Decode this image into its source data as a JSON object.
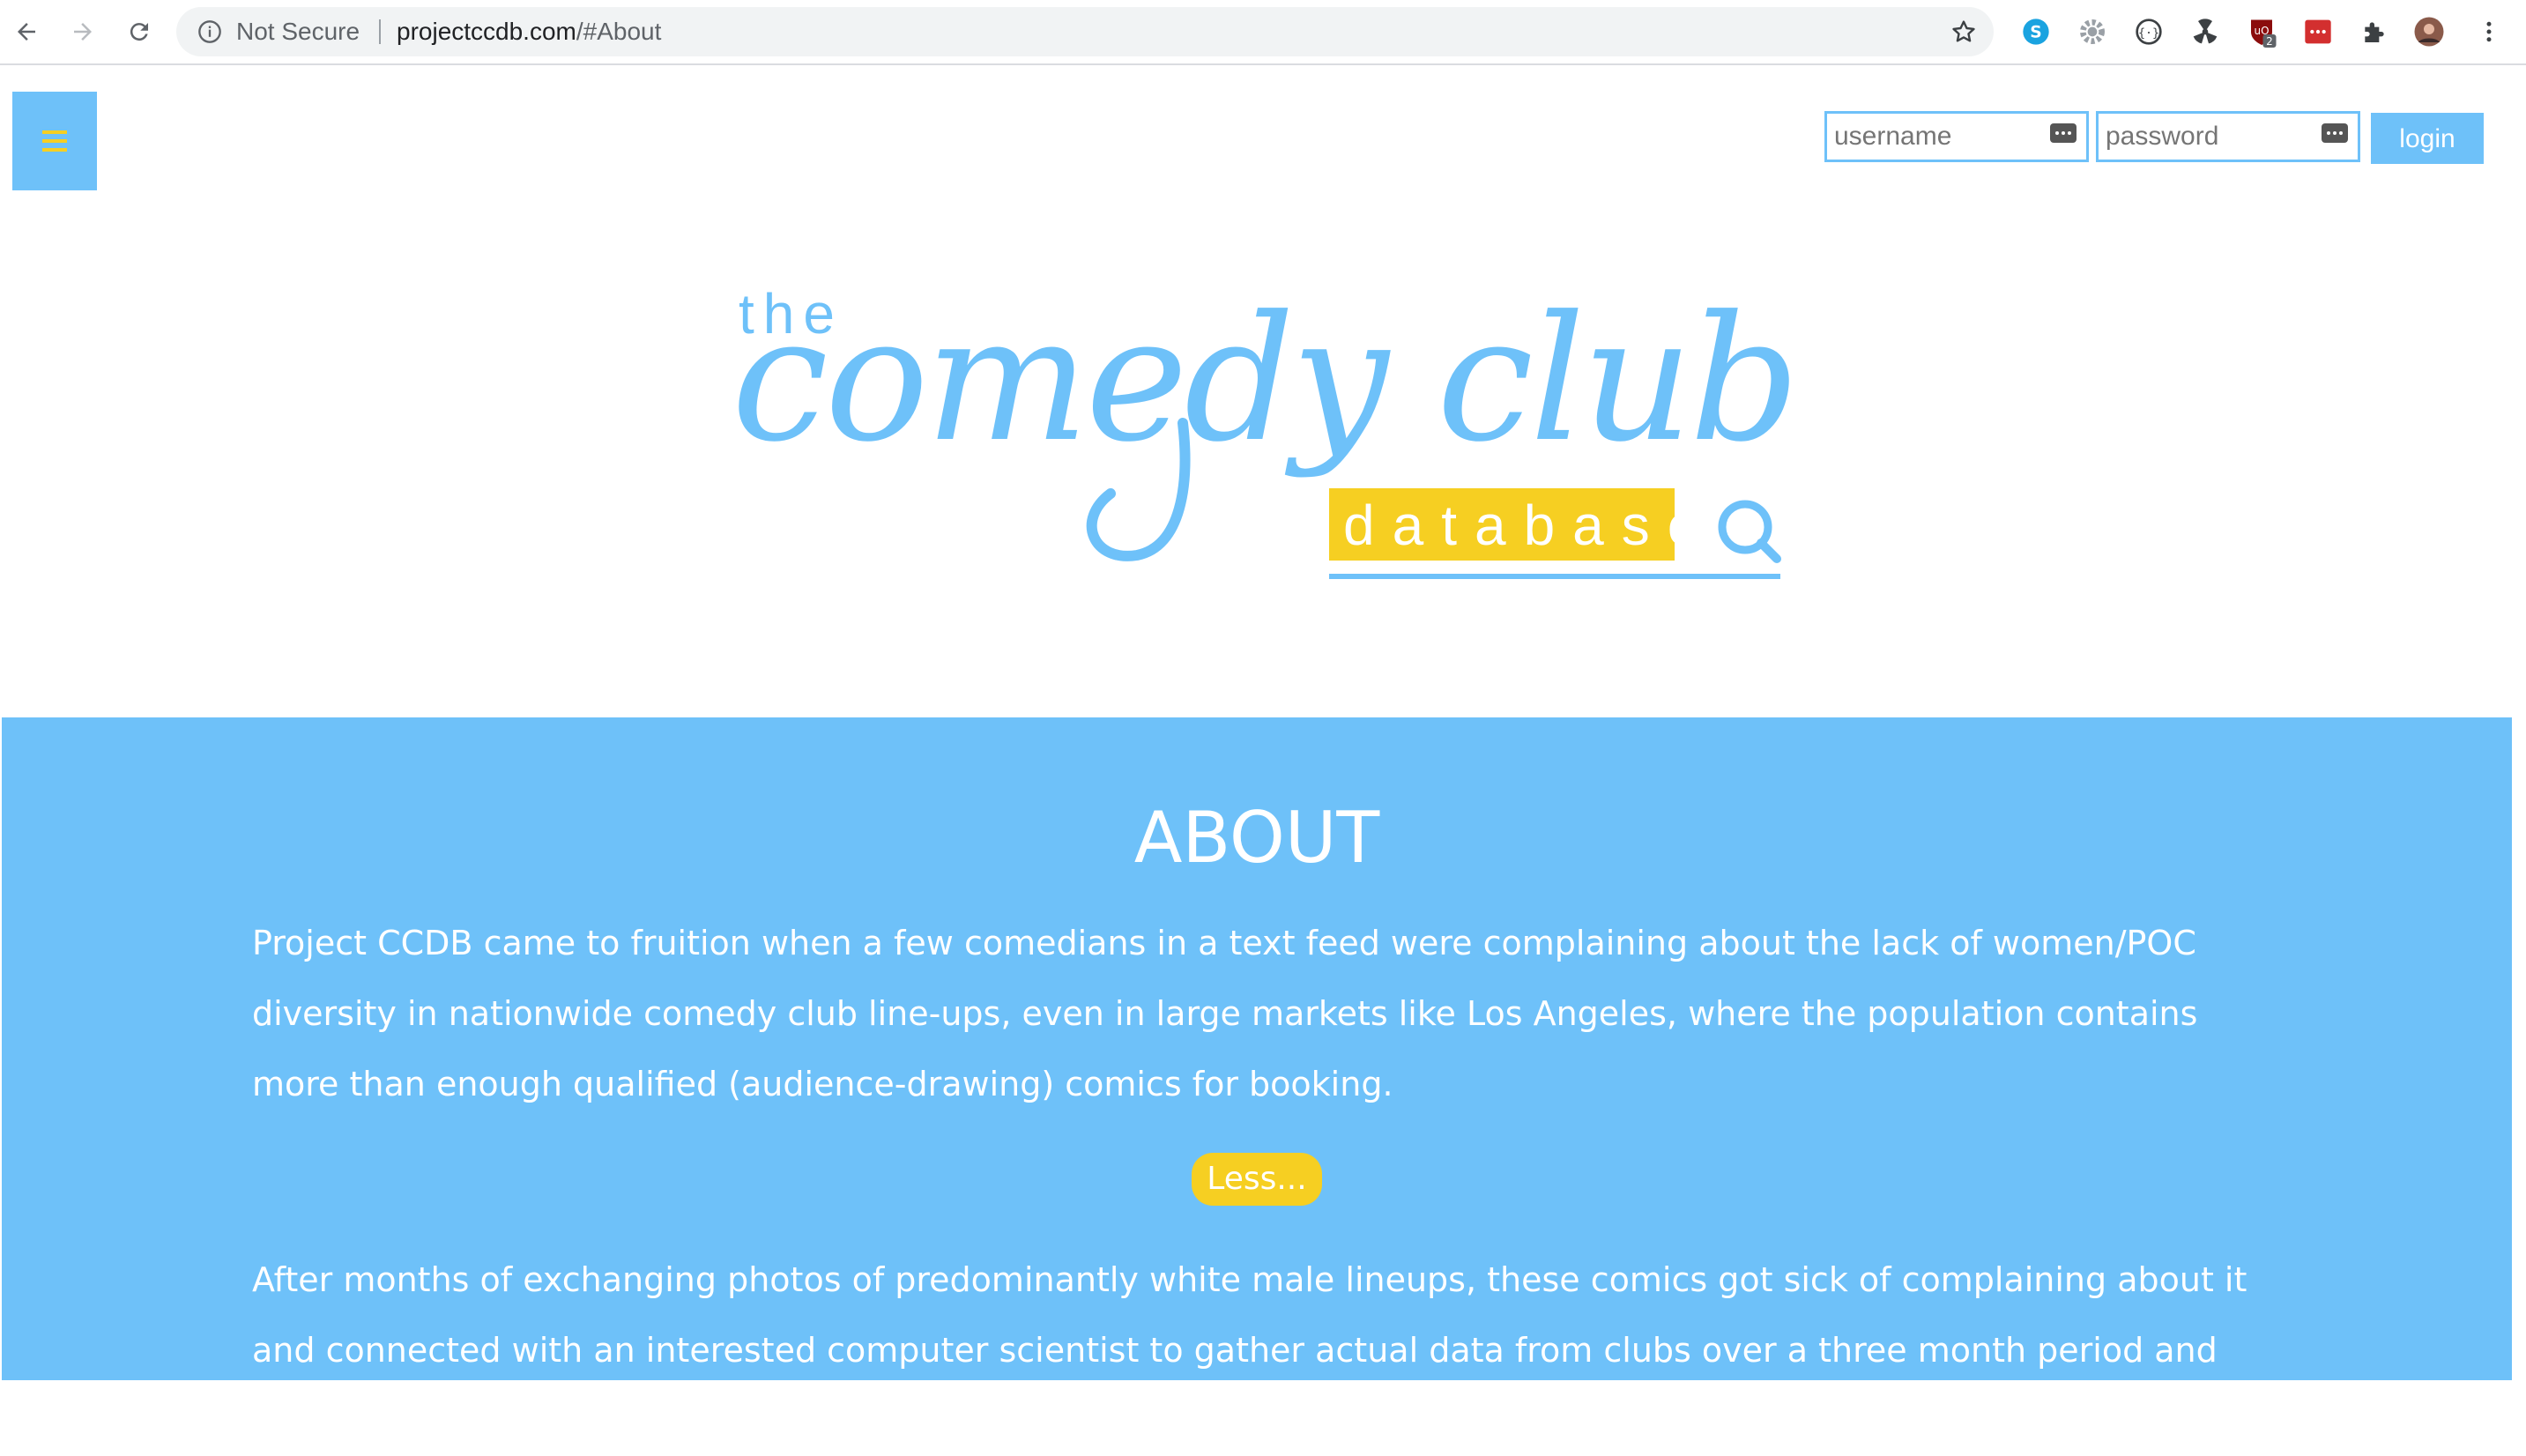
{
  "browser": {
    "security_label": "Not Secure",
    "url_host": "projectccdb.com",
    "url_path": "/#About",
    "extension_badge": "2"
  },
  "header": {
    "username_placeholder": "username",
    "password_placeholder": "password",
    "login_label": "login",
    "menu_icon": "hamburger-icon"
  },
  "logo": {
    "the": "the",
    "comedy_club": "comedy club",
    "database": "database",
    "search_icon": "magnifier-icon"
  },
  "about": {
    "title": "ABOUT",
    "paragraph_1": "Project CCDB came to fruition when a few comedians in a text feed were complaining about the lack of women/POC diversity in nationwide comedy club line-ups, even in large markets like Los Angeles, where the population contains more than enough qualified (audience-drawing) comics for booking.",
    "less_label": "Less...",
    "paragraph_2": "After months of exchanging photos of predominantly white male lineups, these comics got sick of complaining about it and connected with an interested computer scientist to gather actual data from clubs over a three month period and see if the hearsay"
  },
  "colors": {
    "brand_blue": "#6ec1f9",
    "brand_yellow": "#f6cf22"
  }
}
